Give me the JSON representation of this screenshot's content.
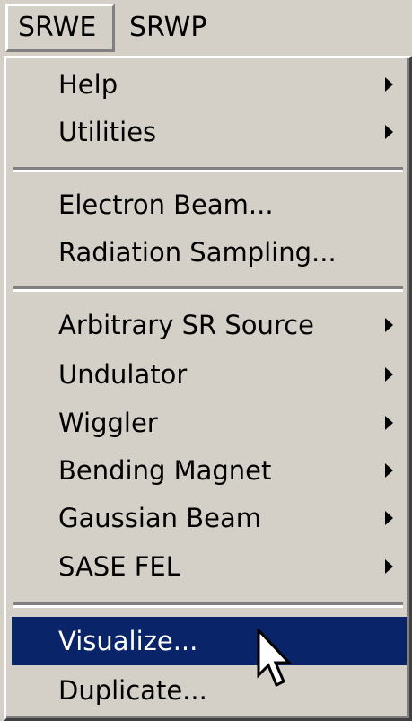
{
  "menubar": {
    "items": [
      {
        "label": "SRWE",
        "active": true
      },
      {
        "label": "SRWP",
        "active": false
      }
    ]
  },
  "menu": {
    "groups": [
      {
        "items": [
          {
            "label": "Help",
            "submenu": true
          },
          {
            "label": "Utilities",
            "submenu": true
          }
        ]
      },
      {
        "items": [
          {
            "label": "Electron Beam...",
            "submenu": false
          },
          {
            "label": "Radiation Sampling...",
            "submenu": false
          }
        ]
      },
      {
        "items": [
          {
            "label": "Arbitrary SR Source",
            "submenu": true
          },
          {
            "label": "Undulator",
            "submenu": true
          },
          {
            "label": "Wiggler",
            "submenu": true
          },
          {
            "label": "Bending Magnet",
            "submenu": true
          },
          {
            "label": "Gaussian Beam",
            "submenu": true
          },
          {
            "label": "SASE FEL",
            "submenu": true
          }
        ]
      },
      {
        "items": [
          {
            "label": "Visualize...",
            "submenu": false,
            "highlighted": true
          },
          {
            "label": "Duplicate...",
            "submenu": false
          }
        ]
      }
    ]
  },
  "colors": {
    "highlight": "#0a246a",
    "face": "#d4d0c8"
  },
  "cursor": {
    "icon": "mouse-pointer-icon"
  }
}
